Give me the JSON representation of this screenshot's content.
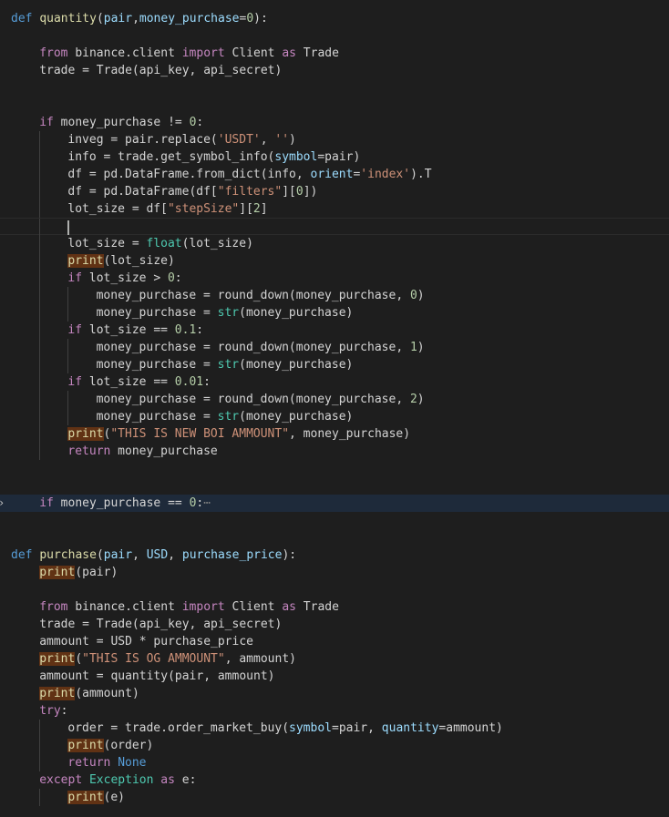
{
  "editor": {
    "language": "python",
    "colors": {
      "background": "#1e1e1e",
      "keyword": "#569cd6",
      "control": "#c586c0",
      "function": "#dcdcaa",
      "parameter": "#9cdcfe",
      "string": "#ce9178",
      "number": "#b5cea8",
      "class": "#4ec9b0",
      "highlight_bg": "#613214",
      "folded_line_bg": "#1e2a3a"
    },
    "lines": [
      {
        "indent": 0,
        "tokens": [
          [
            "kw",
            "def"
          ],
          [
            "plain",
            " "
          ],
          [
            "fn",
            "quantity"
          ],
          [
            "plain",
            "("
          ],
          [
            "param",
            "pair"
          ],
          [
            "plain",
            ","
          ],
          [
            "param",
            "money_purchase"
          ],
          [
            "plain",
            "="
          ],
          [
            "num",
            "0"
          ],
          [
            "plain",
            "):"
          ]
        ]
      },
      {
        "indent": 0,
        "tokens": []
      },
      {
        "indent": 1,
        "tokens": [
          [
            "ctrl",
            "from"
          ],
          [
            "plain",
            " binance.client "
          ],
          [
            "ctrl",
            "import"
          ],
          [
            "plain",
            " Client "
          ],
          [
            "ctrl",
            "as"
          ],
          [
            "plain",
            " Trade"
          ]
        ]
      },
      {
        "indent": 1,
        "tokens": [
          [
            "plain",
            "trade = Trade(api_key, api_secret)"
          ]
        ]
      },
      {
        "indent": 1,
        "tokens": []
      },
      {
        "indent": 1,
        "tokens": []
      },
      {
        "indent": 1,
        "tokens": [
          [
            "ctrl",
            "if"
          ],
          [
            "plain",
            " money_purchase != "
          ],
          [
            "num",
            "0"
          ],
          [
            "plain",
            ":"
          ]
        ]
      },
      {
        "indent": 2,
        "tokens": [
          [
            "plain",
            "inveg = pair.replace("
          ],
          [
            "str",
            "'USDT'"
          ],
          [
            "plain",
            ", "
          ],
          [
            "str",
            "''"
          ],
          [
            "plain",
            ")"
          ]
        ]
      },
      {
        "indent": 2,
        "tokens": [
          [
            "plain",
            "info = trade.get_symbol_info("
          ],
          [
            "param",
            "symbol"
          ],
          [
            "plain",
            "=pair)"
          ]
        ]
      },
      {
        "indent": 2,
        "tokens": [
          [
            "plain",
            "df = pd.DataFrame.from_dict(info, "
          ],
          [
            "param",
            "orient"
          ],
          [
            "plain",
            "="
          ],
          [
            "str",
            "'index'"
          ],
          [
            "plain",
            ").T"
          ]
        ]
      },
      {
        "indent": 2,
        "tokens": [
          [
            "plain",
            "df = pd.DataFrame(df["
          ],
          [
            "str",
            "\"filters\""
          ],
          [
            "plain",
            "]["
          ],
          [
            "num",
            "0"
          ],
          [
            "plain",
            "])"
          ]
        ]
      },
      {
        "indent": 2,
        "tokens": [
          [
            "plain",
            "lot_size = df["
          ],
          [
            "str",
            "\"stepSize\""
          ],
          [
            "plain",
            "]["
          ],
          [
            "num",
            "2"
          ],
          [
            "plain",
            "]"
          ]
        ]
      },
      {
        "indent": 2,
        "tokens": [],
        "cursor": true
      },
      {
        "indent": 2,
        "tokens": [
          [
            "plain",
            "lot_size = "
          ],
          [
            "class",
            "float"
          ],
          [
            "plain",
            "(lot_size)"
          ]
        ]
      },
      {
        "indent": 2,
        "tokens": [
          [
            "hl",
            "print"
          ],
          [
            "plain",
            "(lot_size)"
          ]
        ]
      },
      {
        "indent": 2,
        "tokens": [
          [
            "ctrl",
            "if"
          ],
          [
            "plain",
            " lot_size > "
          ],
          [
            "num",
            "0"
          ],
          [
            "plain",
            ":"
          ]
        ]
      },
      {
        "indent": 3,
        "tokens": [
          [
            "plain",
            "money_purchase = round_down(money_purchase, "
          ],
          [
            "num",
            "0"
          ],
          [
            "plain",
            ")"
          ]
        ]
      },
      {
        "indent": 3,
        "tokens": [
          [
            "plain",
            "money_purchase = "
          ],
          [
            "class",
            "str"
          ],
          [
            "plain",
            "(money_purchase)"
          ]
        ]
      },
      {
        "indent": 2,
        "tokens": [
          [
            "ctrl",
            "if"
          ],
          [
            "plain",
            " lot_size == "
          ],
          [
            "num",
            "0.1"
          ],
          [
            "plain",
            ":"
          ]
        ]
      },
      {
        "indent": 3,
        "tokens": [
          [
            "plain",
            "money_purchase = round_down(money_purchase, "
          ],
          [
            "num",
            "1"
          ],
          [
            "plain",
            ")"
          ]
        ]
      },
      {
        "indent": 3,
        "tokens": [
          [
            "plain",
            "money_purchase = "
          ],
          [
            "class",
            "str"
          ],
          [
            "plain",
            "(money_purchase)"
          ]
        ]
      },
      {
        "indent": 2,
        "tokens": [
          [
            "ctrl",
            "if"
          ],
          [
            "plain",
            " lot_size == "
          ],
          [
            "num",
            "0.01"
          ],
          [
            "plain",
            ":"
          ]
        ]
      },
      {
        "indent": 3,
        "tokens": [
          [
            "plain",
            "money_purchase = round_down(money_purchase, "
          ],
          [
            "num",
            "2"
          ],
          [
            "plain",
            ")"
          ]
        ]
      },
      {
        "indent": 3,
        "tokens": [
          [
            "plain",
            "money_purchase = "
          ],
          [
            "class",
            "str"
          ],
          [
            "plain",
            "(money_purchase)"
          ]
        ]
      },
      {
        "indent": 2,
        "tokens": [
          [
            "hl",
            "print"
          ],
          [
            "plain",
            "("
          ],
          [
            "str",
            "\"THIS IS NEW BOI AMMOUNT\""
          ],
          [
            "plain",
            ", money_purchase)"
          ]
        ]
      },
      {
        "indent": 2,
        "tokens": [
          [
            "ctrl",
            "return"
          ],
          [
            "plain",
            " money_purchase"
          ]
        ]
      },
      {
        "indent": 1,
        "tokens": []
      },
      {
        "indent": 1,
        "tokens": []
      },
      {
        "indent": 1,
        "tokens": [
          [
            "ctrl",
            "if"
          ],
          [
            "plain",
            " money_purchase == "
          ],
          [
            "num",
            "0"
          ],
          [
            "plain",
            ":"
          ],
          [
            "dim",
            "⋯"
          ]
        ],
        "folded": true
      },
      {
        "indent": 0,
        "tokens": []
      },
      {
        "indent": 0,
        "tokens": []
      },
      {
        "indent": 0,
        "tokens": [
          [
            "kw",
            "def"
          ],
          [
            "plain",
            " "
          ],
          [
            "fn",
            "purchase"
          ],
          [
            "plain",
            "("
          ],
          [
            "param",
            "pair"
          ],
          [
            "plain",
            ", "
          ],
          [
            "param",
            "USD"
          ],
          [
            "plain",
            ", "
          ],
          [
            "param",
            "purchase_price"
          ],
          [
            "plain",
            "):"
          ]
        ]
      },
      {
        "indent": 1,
        "tokens": [
          [
            "hl",
            "print"
          ],
          [
            "plain",
            "(pair)"
          ]
        ]
      },
      {
        "indent": 1,
        "tokens": []
      },
      {
        "indent": 1,
        "tokens": [
          [
            "ctrl",
            "from"
          ],
          [
            "plain",
            " binance.client "
          ],
          [
            "ctrl",
            "import"
          ],
          [
            "plain",
            " Client "
          ],
          [
            "ctrl",
            "as"
          ],
          [
            "plain",
            " Trade"
          ]
        ]
      },
      {
        "indent": 1,
        "tokens": [
          [
            "plain",
            "trade = Trade(api_key, api_secret)"
          ]
        ]
      },
      {
        "indent": 1,
        "tokens": [
          [
            "plain",
            "ammount = USD * purchase_price"
          ]
        ]
      },
      {
        "indent": 1,
        "tokens": [
          [
            "hl",
            "print"
          ],
          [
            "plain",
            "("
          ],
          [
            "str",
            "\"THIS IS OG AMMOUNT\""
          ],
          [
            "plain",
            ", ammount)"
          ]
        ]
      },
      {
        "indent": 1,
        "tokens": [
          [
            "plain",
            "ammount = quantity(pair, ammount)"
          ]
        ]
      },
      {
        "indent": 1,
        "tokens": [
          [
            "hl",
            "print"
          ],
          [
            "plain",
            "(ammount)"
          ]
        ]
      },
      {
        "indent": 1,
        "tokens": [
          [
            "ctrl",
            "try"
          ],
          [
            "plain",
            ":"
          ]
        ]
      },
      {
        "indent": 2,
        "tokens": [
          [
            "plain",
            "order = trade.order_market_buy("
          ],
          [
            "param",
            "symbol"
          ],
          [
            "plain",
            "=pair, "
          ],
          [
            "param",
            "quantity"
          ],
          [
            "plain",
            "=ammount)"
          ]
        ]
      },
      {
        "indent": 2,
        "tokens": [
          [
            "hl",
            "print"
          ],
          [
            "plain",
            "(order)"
          ]
        ]
      },
      {
        "indent": 2,
        "tokens": [
          [
            "ctrl",
            "return"
          ],
          [
            "plain",
            " "
          ],
          [
            "kw",
            "None"
          ]
        ]
      },
      {
        "indent": 1,
        "tokens": [
          [
            "ctrl",
            "except"
          ],
          [
            "plain",
            " "
          ],
          [
            "class",
            "Exception"
          ],
          [
            "plain",
            " "
          ],
          [
            "ctrl",
            "as"
          ],
          [
            "plain",
            " e:"
          ]
        ]
      },
      {
        "indent": 2,
        "tokens": [
          [
            "hl",
            "print"
          ],
          [
            "plain",
            "(e)"
          ]
        ]
      }
    ]
  }
}
